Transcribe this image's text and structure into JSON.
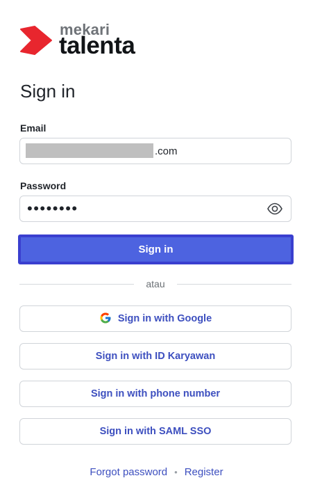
{
  "brand": {
    "top": "mekari",
    "main": "talenta",
    "mark_color": "#e8262e"
  },
  "title": "Sign in",
  "email": {
    "label": "Email",
    "visible_value": ".com"
  },
  "password": {
    "label": "Password",
    "masked_value": "••••••••",
    "toggle_icon": "eye-icon"
  },
  "primary_button": {
    "label": "Sign in",
    "color": "#4d63e0"
  },
  "divider_text": "atau",
  "alt_buttons": {
    "google": "Sign in with Google",
    "id_karyawan": "Sign in with ID Karyawan",
    "phone": "Sign in with phone number",
    "saml": "Sign in with SAML SSO"
  },
  "footer": {
    "forgot": "Forgot password",
    "separator": "•",
    "register": "Register"
  },
  "colors": {
    "link": "#3d4fbf",
    "border": "#d0d4d9"
  }
}
